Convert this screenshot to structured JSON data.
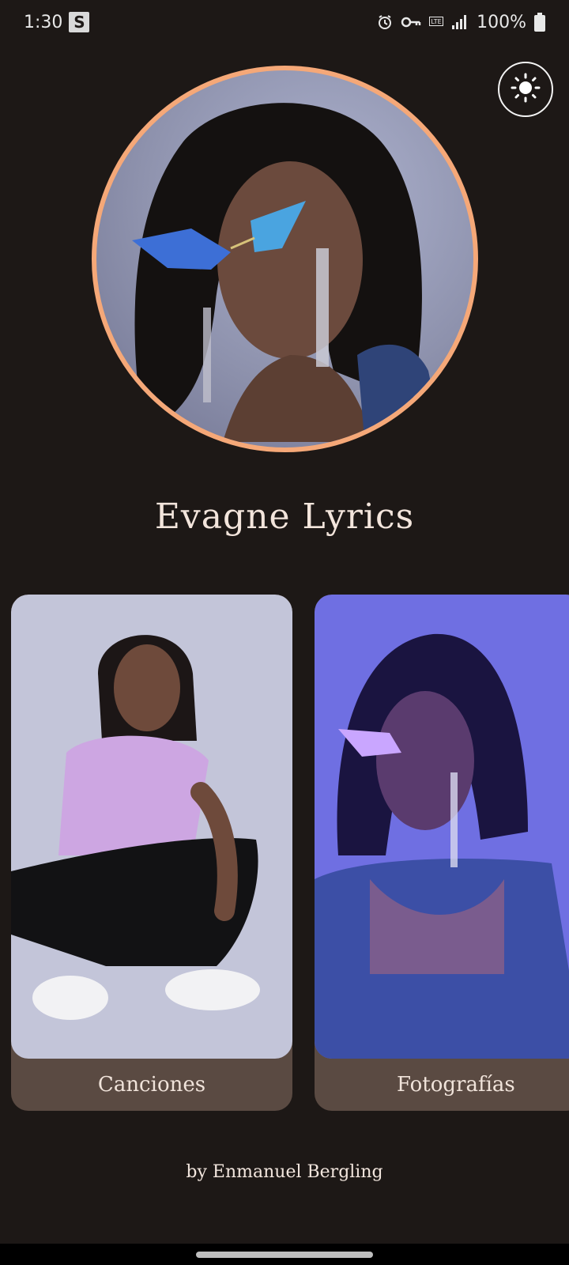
{
  "status_bar": {
    "time": "1:30",
    "badge": "S",
    "lte": "LTE",
    "battery": "100%"
  },
  "icons": {
    "theme_toggle": "sun-icon",
    "alarm": "alarm-icon",
    "vpn": "key-icon",
    "signal": "signal-icon",
    "battery": "battery-icon"
  },
  "app": {
    "title": "Evagne Lyrics",
    "footer": "by Enmanuel Bergling"
  },
  "cards": [
    {
      "label": "Canciones"
    },
    {
      "label": "Fotografías"
    }
  ],
  "colors": {
    "background": "#1d1816",
    "avatar_ring": "#f5a878",
    "card_footer": "#5a4a42",
    "text": "#f3e5dc"
  }
}
